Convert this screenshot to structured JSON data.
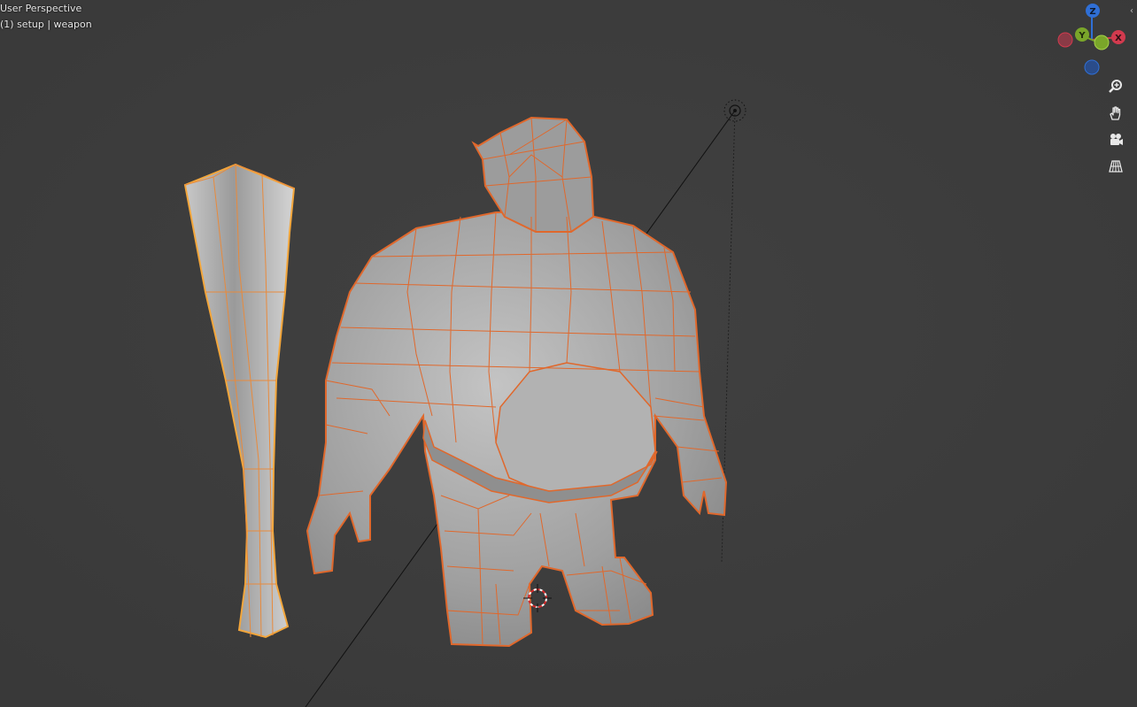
{
  "viewport": {
    "view_name": "User Perspective",
    "view_info": "(1) setup | weapon"
  },
  "gizmo": {
    "axes": [
      {
        "label": "Z",
        "color": "#2f6fd6"
      },
      {
        "label": "Y",
        "color": "#7aa62a"
      },
      {
        "label": "X",
        "color": "#d23a4e"
      }
    ]
  },
  "nav_tools": [
    {
      "name": "zoom",
      "icon": "magnifier-plus-icon"
    },
    {
      "name": "pan",
      "icon": "hand-icon"
    },
    {
      "name": "camera",
      "icon": "camera-icon"
    },
    {
      "name": "perspective",
      "icon": "grid-perspective-icon"
    }
  ],
  "sidebar_toggle": "‹",
  "colors": {
    "background": "#3d3d3d",
    "mesh_fill": "#a8a8a8",
    "wire_selected": "#e06a2e",
    "wire_active": "#f3a63b"
  }
}
